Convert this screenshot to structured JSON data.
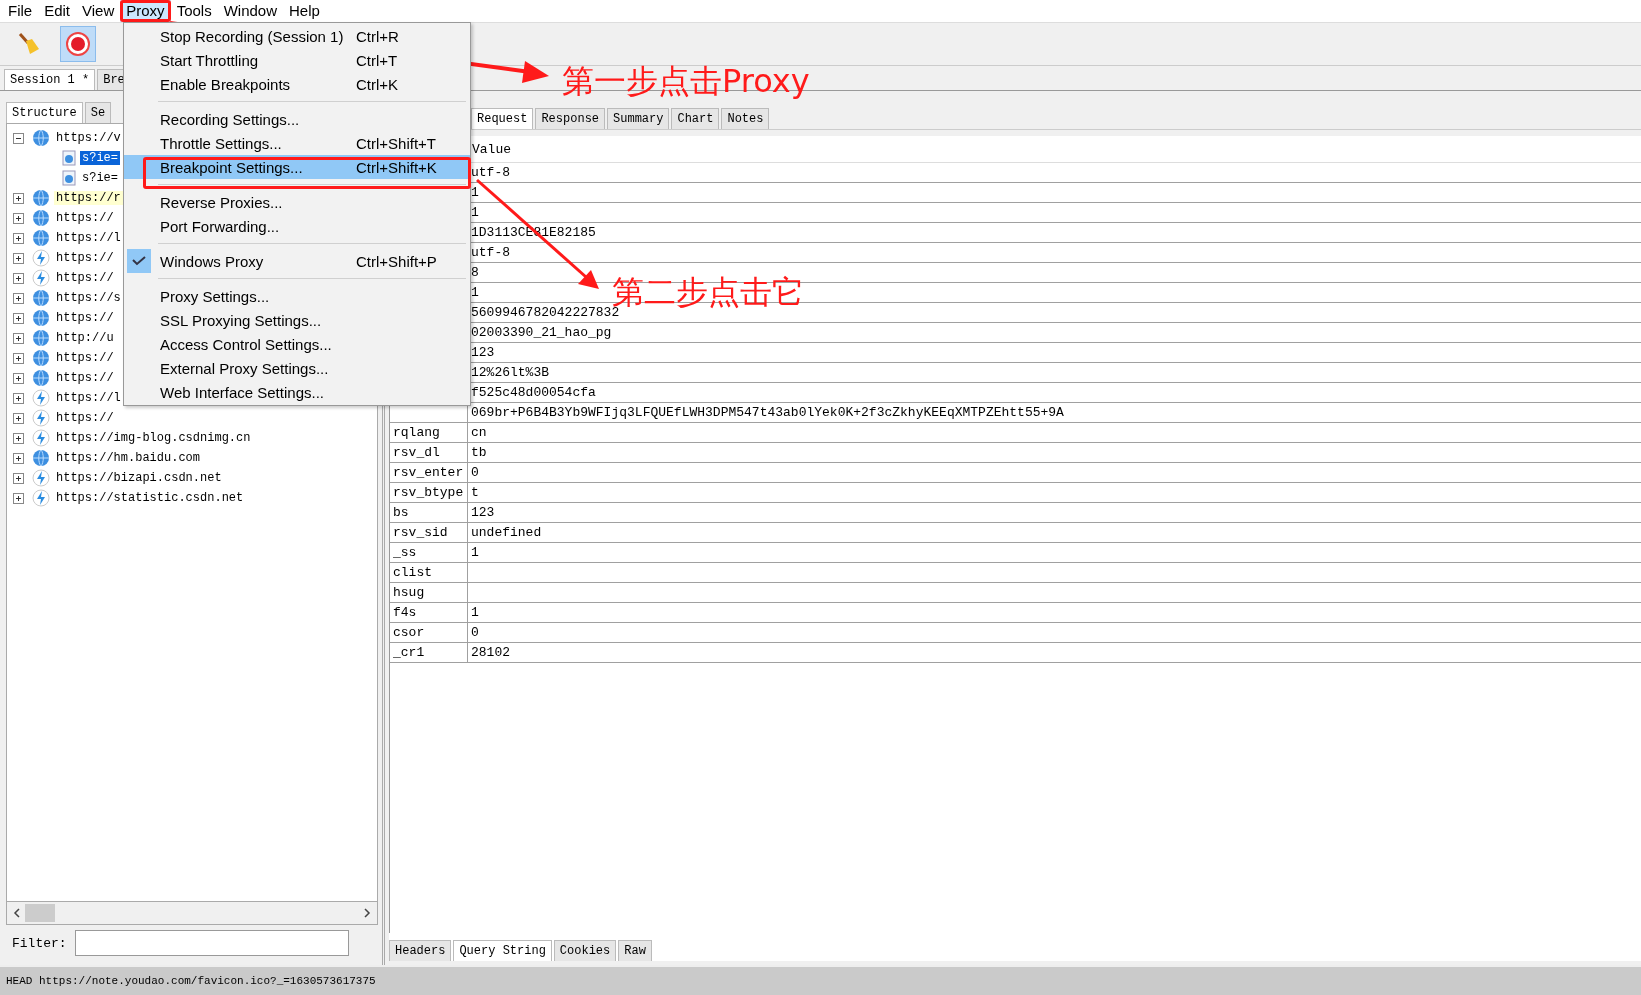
{
  "menubar": [
    {
      "label": "File",
      "selected": false
    },
    {
      "label": "Edit",
      "selected": false
    },
    {
      "label": "View",
      "selected": false
    },
    {
      "label": "Proxy",
      "selected": true
    },
    {
      "label": "Tools",
      "selected": false
    },
    {
      "label": "Window",
      "selected": false
    },
    {
      "label": "Help",
      "selected": false
    }
  ],
  "toolbar": [
    {
      "kind": "broom",
      "pressed": false
    },
    {
      "kind": "record",
      "pressed": true
    }
  ],
  "session_tabs": [
    {
      "label": "Session 1 *",
      "selected": true
    },
    {
      "label": "Bre",
      "selected": false
    }
  ],
  "left_panel": {
    "tabs": [
      {
        "label": "Structure",
        "selected": true
      },
      {
        "label": "Se",
        "selected": false
      }
    ],
    "tree": [
      {
        "label": "https://v",
        "kind": "globe",
        "expanded": true,
        "selected": false,
        "highlighted": false,
        "children": [
          {
            "label": "s?ie=",
            "kind": "file",
            "selected": true,
            "highlighted": false
          },
          {
            "label": "s?ie=",
            "kind": "file",
            "selected": false,
            "highlighted": false
          }
        ]
      },
      {
        "label": "https://r",
        "kind": "globe",
        "expanded": false,
        "selected": false,
        "highlighted": true
      },
      {
        "label": "https://",
        "kind": "globe",
        "expanded": false,
        "selected": false,
        "highlighted": false
      },
      {
        "label": "https://l",
        "kind": "globe",
        "expanded": false,
        "selected": false,
        "highlighted": false
      },
      {
        "label": "https://",
        "kind": "bolt",
        "expanded": false,
        "selected": false,
        "highlighted": false
      },
      {
        "label": "https://",
        "kind": "bolt",
        "expanded": false,
        "selected": false,
        "highlighted": false
      },
      {
        "label": "https://s",
        "kind": "globe",
        "expanded": false,
        "selected": false,
        "highlighted": false
      },
      {
        "label": "https://",
        "kind": "globe",
        "expanded": false,
        "selected": false,
        "highlighted": false
      },
      {
        "label": "http://u",
        "kind": "globe",
        "expanded": false,
        "selected": false,
        "highlighted": false
      },
      {
        "label": "https://",
        "kind": "globe",
        "expanded": false,
        "selected": false,
        "highlighted": false
      },
      {
        "label": "https://",
        "kind": "globe",
        "expanded": false,
        "selected": false,
        "highlighted": false
      },
      {
        "label": "https://l",
        "kind": "bolt",
        "expanded": false,
        "selected": false,
        "highlighted": false
      },
      {
        "label": "https://",
        "kind": "bolt",
        "expanded": false,
        "selected": false,
        "highlighted": false
      },
      {
        "label": "https://img-blog.csdnimg.cn",
        "kind": "bolt",
        "expanded": false,
        "selected": false,
        "highlighted": false
      },
      {
        "label": "https://hm.baidu.com",
        "kind": "globe",
        "expanded": false,
        "selected": false,
        "highlighted": false
      },
      {
        "label": "https://bizapi.csdn.net",
        "kind": "bolt",
        "expanded": false,
        "selected": false,
        "highlighted": false
      },
      {
        "label": "https://statistic.csdn.net",
        "kind": "bolt",
        "expanded": false,
        "selected": false,
        "highlighted": false
      }
    ],
    "filter_label": "Filter:"
  },
  "right_panel": {
    "tabs": [
      {
        "label": "Request",
        "selected": true
      },
      {
        "label": "Response",
        "selected": false
      },
      {
        "label": "Summary",
        "selected": false
      },
      {
        "label": "Chart",
        "selected": false
      },
      {
        "label": "Notes",
        "selected": false
      }
    ],
    "table": {
      "columns": [
        "Value"
      ],
      "rows": [
        {
          "value": "utf-8"
        },
        {
          "value": "1"
        },
        {
          "value": "1"
        },
        {
          "value": "1D3113CE81E82185"
        },
        {
          "value": "utf-8"
        },
        {
          "value": "8"
        },
        {
          "value": "1"
        },
        {
          "value": "5609946782042227832"
        },
        {
          "value": "02003390_21_hao_pg"
        },
        {
          "value": "123"
        },
        {
          "value": "12%26lt%3B"
        },
        {
          "value": "f525c48d00054cfa"
        },
        {
          "value": "069br+P6B4B3Yb9WFIjq3LFQUEfLWH3DPM547t43ab0lYek0K+2f3cZkhyKEEqXMTPZEhtt55+9A"
        },
        {
          "name": "rqlang",
          "value": "cn"
        },
        {
          "name": "rsv_dl",
          "value": "tb"
        },
        {
          "name": "rsv_enter",
          "value": "0"
        },
        {
          "name": "rsv_btype",
          "value": "t"
        },
        {
          "name": "bs",
          "value": "123"
        },
        {
          "name": "rsv_sid",
          "value": "undefined"
        },
        {
          "name": "_ss",
          "value": "1"
        },
        {
          "name": "clist"
        },
        {
          "name": "hsug"
        },
        {
          "name": "f4s",
          "value": "1"
        },
        {
          "name": "csor",
          "value": "0"
        },
        {
          "name": "_cr1",
          "value": "28102"
        }
      ]
    },
    "bottom_tabs": [
      {
        "label": "Headers",
        "selected": false
      },
      {
        "label": "Query String",
        "selected": true
      },
      {
        "label": "Cookies",
        "selected": false
      },
      {
        "label": "Raw",
        "selected": false
      }
    ]
  },
  "status_bar": "HEAD https://note.youdao.com/favicon.ico?_=1630573617375",
  "proxy_menu": [
    {
      "kind": "item",
      "label": "Stop Recording (Session 1)",
      "shortcut": "Ctrl+R",
      "selected": false,
      "checked": false
    },
    {
      "kind": "item",
      "label": "Start Throttling",
      "shortcut": "Ctrl+T",
      "selected": false,
      "checked": false
    },
    {
      "kind": "item",
      "label": "Enable Breakpoints",
      "shortcut": "Ctrl+K",
      "selected": false,
      "checked": false
    },
    {
      "kind": "separator"
    },
    {
      "kind": "item",
      "label": "Recording Settings...",
      "selected": false,
      "checked": false
    },
    {
      "kind": "item",
      "label": "Throttle Settings...",
      "shortcut": "Ctrl+Shift+T",
      "selected": false,
      "checked": false
    },
    {
      "kind": "item",
      "label": "Breakpoint Settings...",
      "shortcut": "Ctrl+Shift+K",
      "selected": true,
      "checked": false
    },
    {
      "kind": "separator"
    },
    {
      "kind": "item",
      "label": "Reverse Proxies...",
      "selected": false,
      "checked": false
    },
    {
      "kind": "item",
      "label": "Port Forwarding...",
      "selected": false,
      "checked": false
    },
    {
      "kind": "separator"
    },
    {
      "kind": "item",
      "label": "Windows Proxy",
      "shortcut": "Ctrl+Shift+P",
      "selected": false,
      "checked": true
    },
    {
      "kind": "separator"
    },
    {
      "kind": "item",
      "label": "Proxy Settings...",
      "selected": false,
      "checked": false
    },
    {
      "kind": "item",
      "label": "SSL Proxying Settings...",
      "selected": false,
      "checked": false
    },
    {
      "kind": "item",
      "label": "Access Control Settings...",
      "selected": false,
      "checked": false
    },
    {
      "kind": "item",
      "label": "External Proxy Settings...",
      "selected": false,
      "checked": false
    },
    {
      "kind": "item",
      "label": "Web Interface Settings...",
      "selected": false,
      "checked": false
    }
  ],
  "annotations": [
    "第一步点击Proxy",
    "第二步点击它"
  ]
}
